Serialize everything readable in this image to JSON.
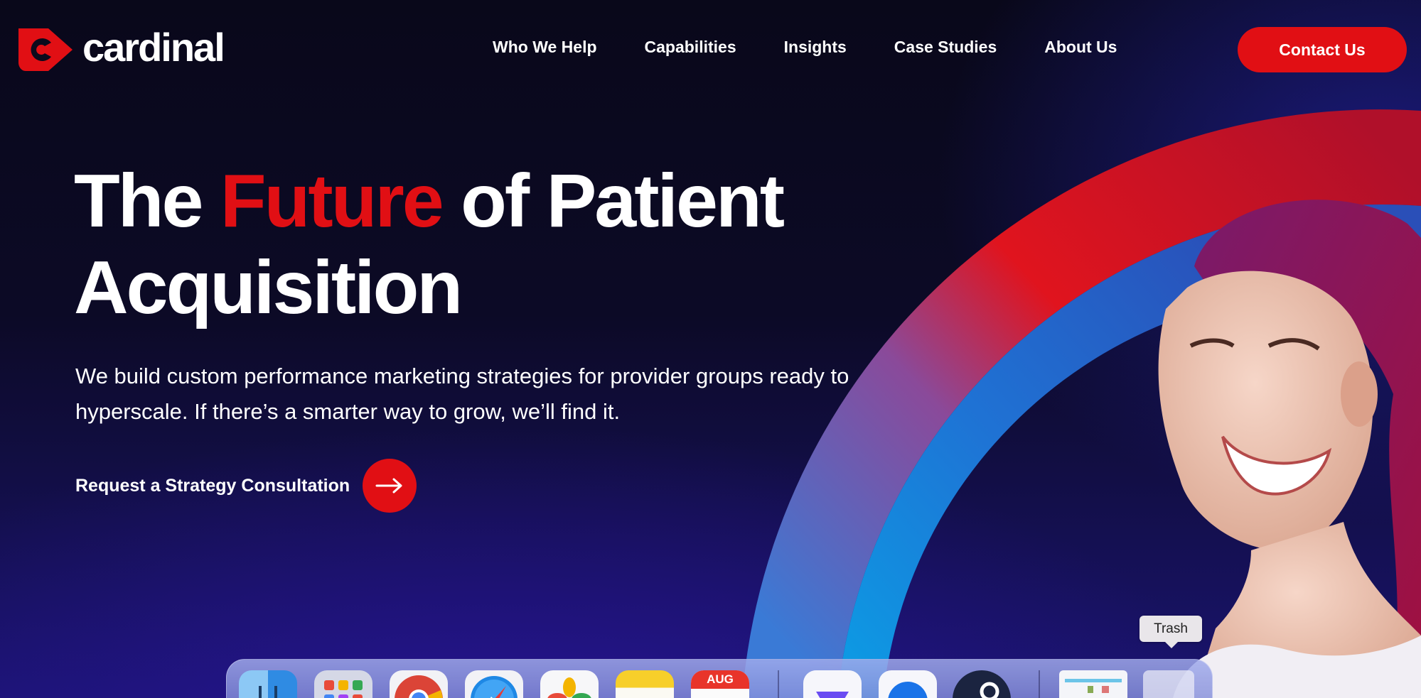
{
  "brand": {
    "name": "cardinal",
    "accent": "#e10f14"
  },
  "nav": {
    "items": [
      {
        "label": "Who We Help"
      },
      {
        "label": "Capabilities"
      },
      {
        "label": "Insights"
      },
      {
        "label": "Case Studies"
      },
      {
        "label": "About Us"
      }
    ],
    "contact_label": "Contact Us"
  },
  "hero": {
    "headline_part1": "The ",
    "headline_accent": "Future",
    "headline_part2": " of Patient",
    "headline_line2": "Acquisition",
    "subtext": "We build custom performance marketing strategies for provider groups ready to hyperscale. If there’s a smarter way to grow, we’ll find it.",
    "cta_label": "Request a Strategy Consultation"
  },
  "dock": {
    "tooltip": "Trash",
    "calendar_month": "AUG",
    "apps": [
      "finder-icon",
      "launchpad-icon",
      "chrome-icon",
      "safari-icon",
      "photos-icon",
      "notes-icon",
      "calendar-icon",
      "linear-icon",
      "app-store-icon",
      "steam-icon",
      "screenshot-thumbnail",
      "trash-icon"
    ]
  }
}
